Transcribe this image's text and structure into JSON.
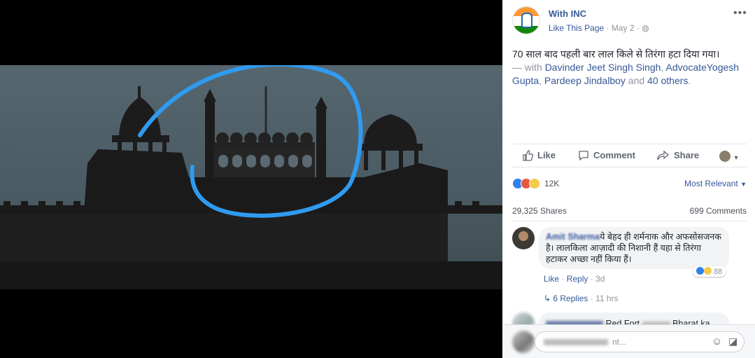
{
  "post": {
    "page_name": "With INC",
    "like_link": "Like This Page",
    "date": "May 2",
    "text": "70 साल बाद पहली बार लाल किले से तिरंगा हटा दिया गया।",
    "with_prefix": "— with",
    "tag_1": "Davinder Jeet Singh Singh",
    "tag_2": "AdvocateYogesh Gupta",
    "tag_3": "Pardeep Jindalboy",
    "and_word": "and",
    "tag_others": "40 others",
    "period": "."
  },
  "actions": {
    "like": "Like",
    "comment": "Comment",
    "share": "Share"
  },
  "stats": {
    "reactions_count": "12K",
    "sort": "Most Relevant",
    "shares": "29,325 Shares",
    "comments": "699 Comments"
  },
  "comment_1": {
    "author": "Amit Sharma",
    "text": "ये बेहद ही शर्मनाक और अफसोसजनक है। लालकिला आज़ादी की निशानी हैं यहा से तिरंगा हटाकर अच्छा नहीं किया हैं।",
    "reactions_count": "88",
    "like": "Like",
    "reply": "Reply",
    "time": "3d",
    "replies_link": "6 Replies",
    "replies_time": "11 hrs"
  },
  "comment_2": {
    "text_a": "Red Fort",
    "text_b": "Bharat ka"
  },
  "composer": {
    "placeholder_tail": "nt..."
  },
  "colors": {
    "fb_link": "#365899",
    "meta_gray": "#90949c",
    "annotation_circle": "#2f9bf0",
    "saffron": "#ff9933",
    "green": "#138808"
  }
}
